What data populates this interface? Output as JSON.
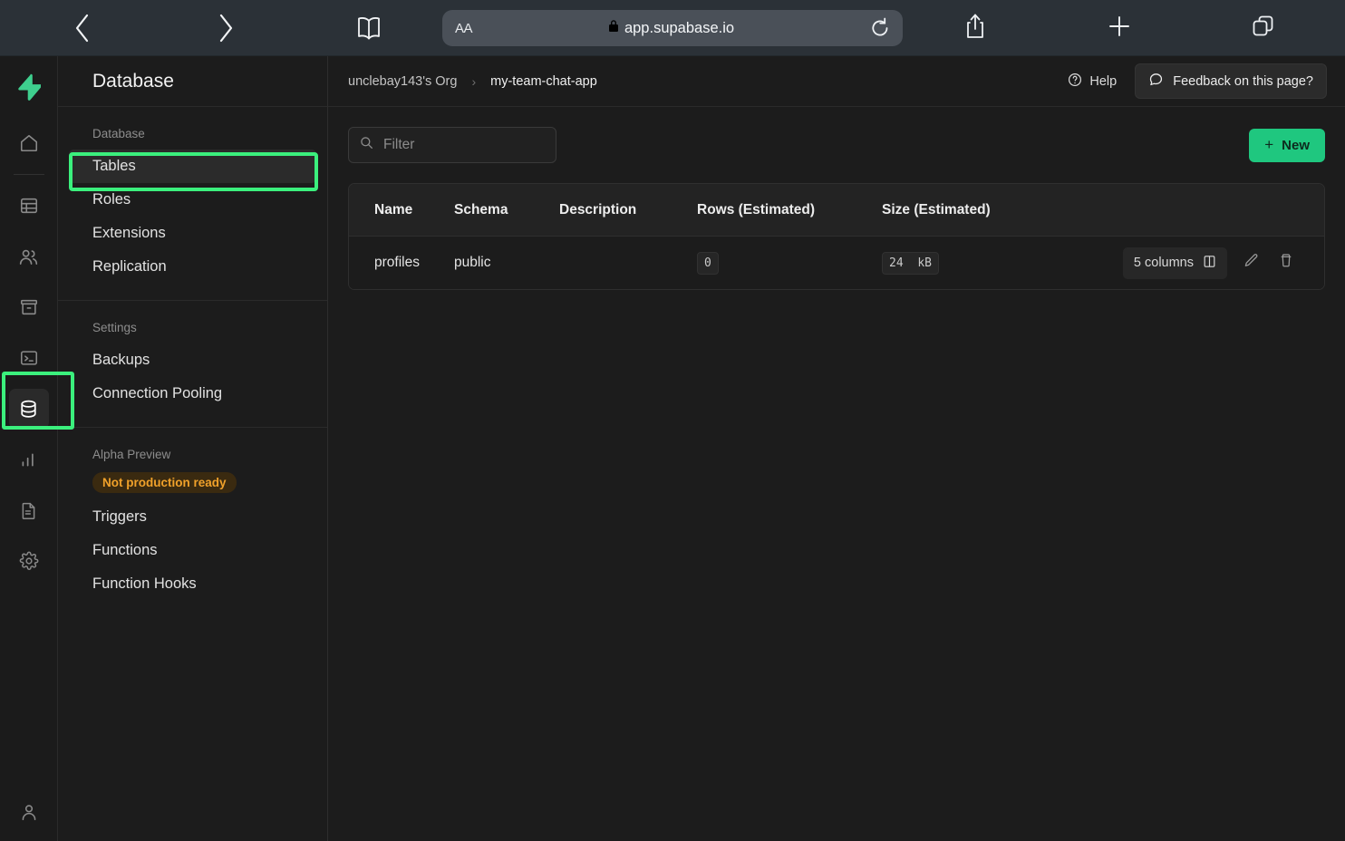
{
  "browser": {
    "back_icon": "chevron-left-icon",
    "forward_icon": "chevron-right-icon",
    "bookmarks_icon": "book-icon",
    "text_size_label": "AA",
    "lock_icon": "lock-icon",
    "url": "app.supabase.io",
    "reload_icon": "reload-icon",
    "share_icon": "share-icon",
    "new_tab_icon": "plus-icon",
    "tabs_icon": "tabs-icon"
  },
  "rail": {
    "logo": "supabase-logo",
    "items": [
      {
        "name": "home",
        "icon": "home-icon",
        "active": false
      },
      {
        "name": "table-editor",
        "icon": "table-icon",
        "active": false
      },
      {
        "name": "authentication",
        "icon": "users-icon",
        "active": false
      },
      {
        "name": "storage",
        "icon": "archive-icon",
        "active": false
      },
      {
        "name": "sql-editor",
        "icon": "terminal-icon",
        "active": false
      },
      {
        "name": "database",
        "icon": "database-icon",
        "active": true
      },
      {
        "name": "reports",
        "icon": "bar-chart-icon",
        "active": false
      },
      {
        "name": "logs",
        "icon": "file-text-icon",
        "active": false
      },
      {
        "name": "settings",
        "icon": "gear-icon",
        "active": false
      }
    ],
    "account_icon": "user-icon"
  },
  "sidebar": {
    "title": "Database",
    "groups": [
      {
        "label": "Database",
        "items": [
          {
            "label": "Tables",
            "active": true
          },
          {
            "label": "Roles",
            "active": false
          },
          {
            "label": "Extensions",
            "active": false
          },
          {
            "label": "Replication",
            "active": false
          }
        ]
      },
      {
        "label": "Settings",
        "items": [
          {
            "label": "Backups",
            "active": false
          },
          {
            "label": "Connection Pooling",
            "active": false
          }
        ]
      },
      {
        "label": "Alpha Preview",
        "badge": "Not production ready",
        "items": [
          {
            "label": "Triggers",
            "active": false
          },
          {
            "label": "Functions",
            "active": false
          },
          {
            "label": "Function Hooks",
            "active": false
          }
        ]
      }
    ]
  },
  "topbar": {
    "breadcrumb_org": "unclebay143's Org",
    "breadcrumb_sep": "›",
    "breadcrumb_project": "my-team-chat-app",
    "help_label": "Help",
    "help_icon": "question-circle-icon",
    "feedback_label": "Feedback on this page?",
    "feedback_icon": "speech-bubble-icon"
  },
  "toolbar": {
    "filter_placeholder": "Filter",
    "search_icon": "search-icon",
    "new_label": "New",
    "new_plus": "+"
  },
  "table": {
    "columns": [
      "Name",
      "Schema",
      "Description",
      "Rows (Estimated)",
      "Size (Estimated)"
    ],
    "rows": [
      {
        "name": "profiles",
        "schema": "public",
        "description": "",
        "rows_estimated": "0",
        "size_estimated_value": "24",
        "size_estimated_unit": "kB",
        "columns_badge": "5 columns",
        "columns_icon": "columns-icon",
        "edit_icon": "pencil-icon",
        "delete_icon": "trash-icon"
      }
    ]
  },
  "annotations": {
    "highlight_color": "#3bf07d",
    "highlighted_rail_item": "database",
    "highlighted_sidebar_item": "Tables"
  }
}
